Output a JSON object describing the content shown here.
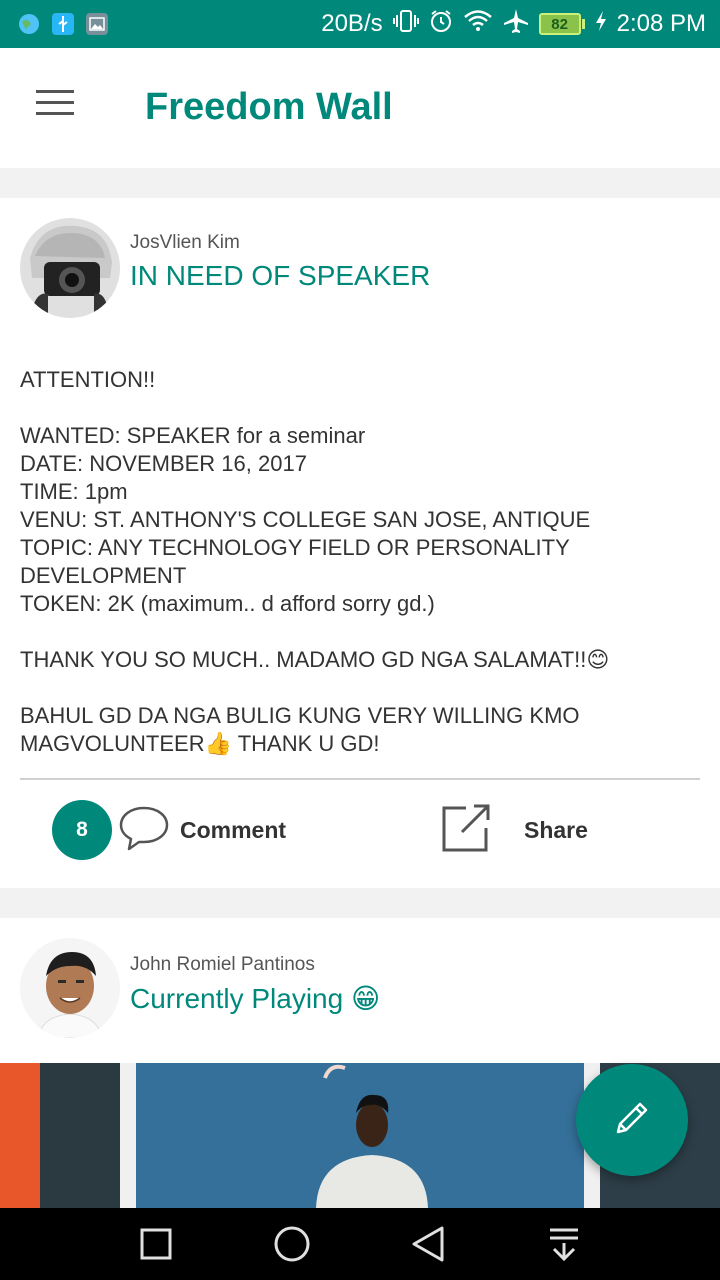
{
  "status_bar": {
    "net_speed": "20B/s",
    "battery": "82",
    "time": "2:08 PM",
    "icons": [
      "earth-icon",
      "usb-icon",
      "image-icon",
      "vibrate-icon",
      "alarm-icon",
      "wifi-icon",
      "airplane-icon",
      "battery-icon",
      "charging-icon"
    ]
  },
  "app_bar": {
    "title": "Freedom Wall",
    "menu_icon": "hamburger-menu-icon"
  },
  "posts": [
    {
      "author": "JosVlien Kim",
      "title": "IN NEED OF SPEAKER",
      "body": [
        "ATTENTION!!",
        "",
        "WANTED: SPEAKER for a seminar",
        "DATE: NOVEMBER 16, 2017",
        "TIME: 1pm",
        "VENU: ST. ANTHONY'S COLLEGE SAN JOSE, ANTIQUE",
        "TOPIC: ANY TECHNOLOGY FIELD OR PERSONALITY DEVELOPMENT",
        "TOKEN: 2K (maximum.. d afford sorry gd.)",
        "",
        "THANK YOU SO MUCH.. MADAMO GD NGA SALAMAT!!😊",
        "",
        "BAHUL GD DA NGA BULIG KUNG VERY WILLING KMO MAGVOLUNTEER👍 THANK U GD!"
      ],
      "comment_count": "8",
      "comment_label": "Comment",
      "share_label": "Share"
    },
    {
      "author": "John Romiel Pantinos",
      "title": "Currently Playing 😁"
    }
  ],
  "colors": {
    "accent": "#00897b",
    "status_bar": "#00897b",
    "background": "#f2f2f2"
  }
}
